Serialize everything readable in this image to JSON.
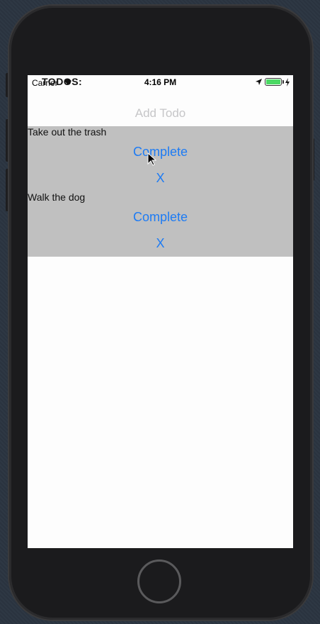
{
  "status_bar": {
    "carrier": "Carrier",
    "time": "4:16 PM",
    "battery_level": 1.0
  },
  "nav": {
    "title": "TODOS:"
  },
  "add_todo_label": "Add Todo",
  "todos": [
    {
      "text": "Take out the trash",
      "complete_label": "Complete",
      "delete_label": "X"
    },
    {
      "text": "Walk the dog",
      "complete_label": "Complete",
      "delete_label": "X"
    }
  ],
  "colors": {
    "accent": "#1d7bf4",
    "list_background": "#c0c0c0",
    "placeholder": "#c6c6c8",
    "battery": "#4cd964"
  },
  "icons": [
    "wifi-icon",
    "location-icon",
    "battery-icon",
    "charge-icon",
    "cursor-icon",
    "home-button"
  ]
}
